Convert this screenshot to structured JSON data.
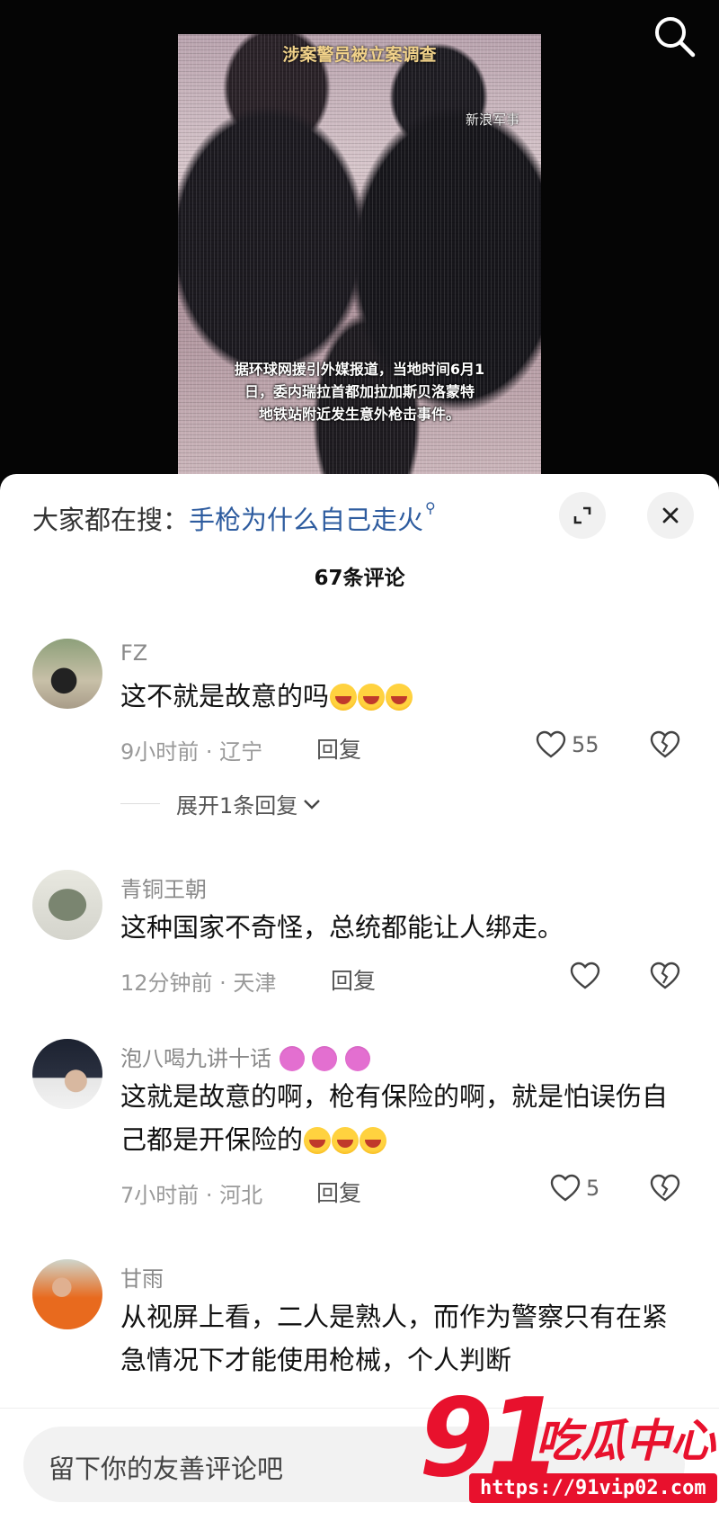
{
  "video": {
    "title": "涉案警员被立案调查",
    "watermark": "新浪军事",
    "caption_lines": [
      "据环球网援引外媒报道，当地时间6月1",
      "日，委内瑞拉首都加拉加斯贝洛蒙特",
      "地铁站附近发生意外枪击事件。"
    ]
  },
  "sheet": {
    "search_suggest_label": "大家都在搜：",
    "search_suggest_term": "手枪为什么自己走火",
    "comment_count": "67条评论",
    "input_placeholder": "留下你的友善评论吧"
  },
  "comments": [
    {
      "name": "FZ",
      "text": "这不就是故意的吗",
      "meta": "9小时前 · 辽宁",
      "reply": "回复",
      "likes": "55",
      "expand": "展开1条回复"
    },
    {
      "name": "青铜王朝",
      "text": "这种国家不奇怪，总统都能让人绑走。",
      "meta": "12分钟前 · 天津",
      "reply": "回复",
      "likes": ""
    },
    {
      "name": "泡八喝九讲十话",
      "text": "这就是故意的啊，枪有保险的啊，就是怕误伤自己都是开保险的",
      "meta": "7小时前 · 河北",
      "reply": "回复",
      "likes": "5"
    },
    {
      "name": "甘雨",
      "text": "从视屏上看，二人是熟人，而作为警察只有在紧急情况下才能使用枪械，个人判断"
    }
  ],
  "watermark": {
    "brand": "91",
    "brand_cn": "吃瓜中心",
    "url": "https://91vip02.com"
  },
  "colors": {
    "accent_link": "#2e5c9f",
    "watermark_red": "#e8112d"
  }
}
